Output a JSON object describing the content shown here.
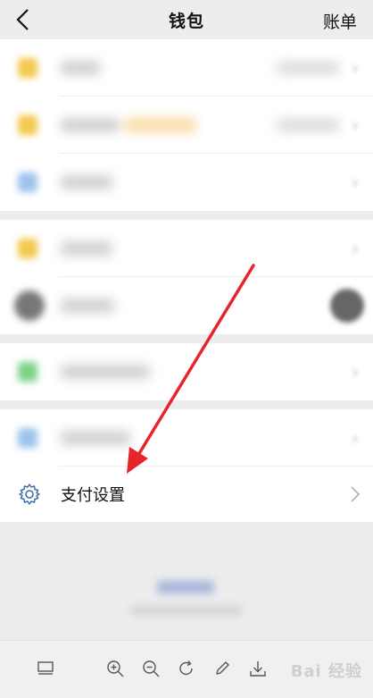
{
  "header": {
    "title": "钱包",
    "right_label": "账单"
  },
  "settings_row": {
    "label": "支付设置"
  },
  "footer": {
    "watermark": "Bai 经验"
  },
  "colors": {
    "background": "#ededed",
    "accent_arrow": "#e8242b",
    "icon_blue": "#3b6ea8"
  },
  "toolbar": {
    "icons": [
      "thumbnail-icon",
      "zoom-in-icon",
      "zoom-out-icon",
      "rotate-icon",
      "edit-icon",
      "download-icon"
    ]
  }
}
